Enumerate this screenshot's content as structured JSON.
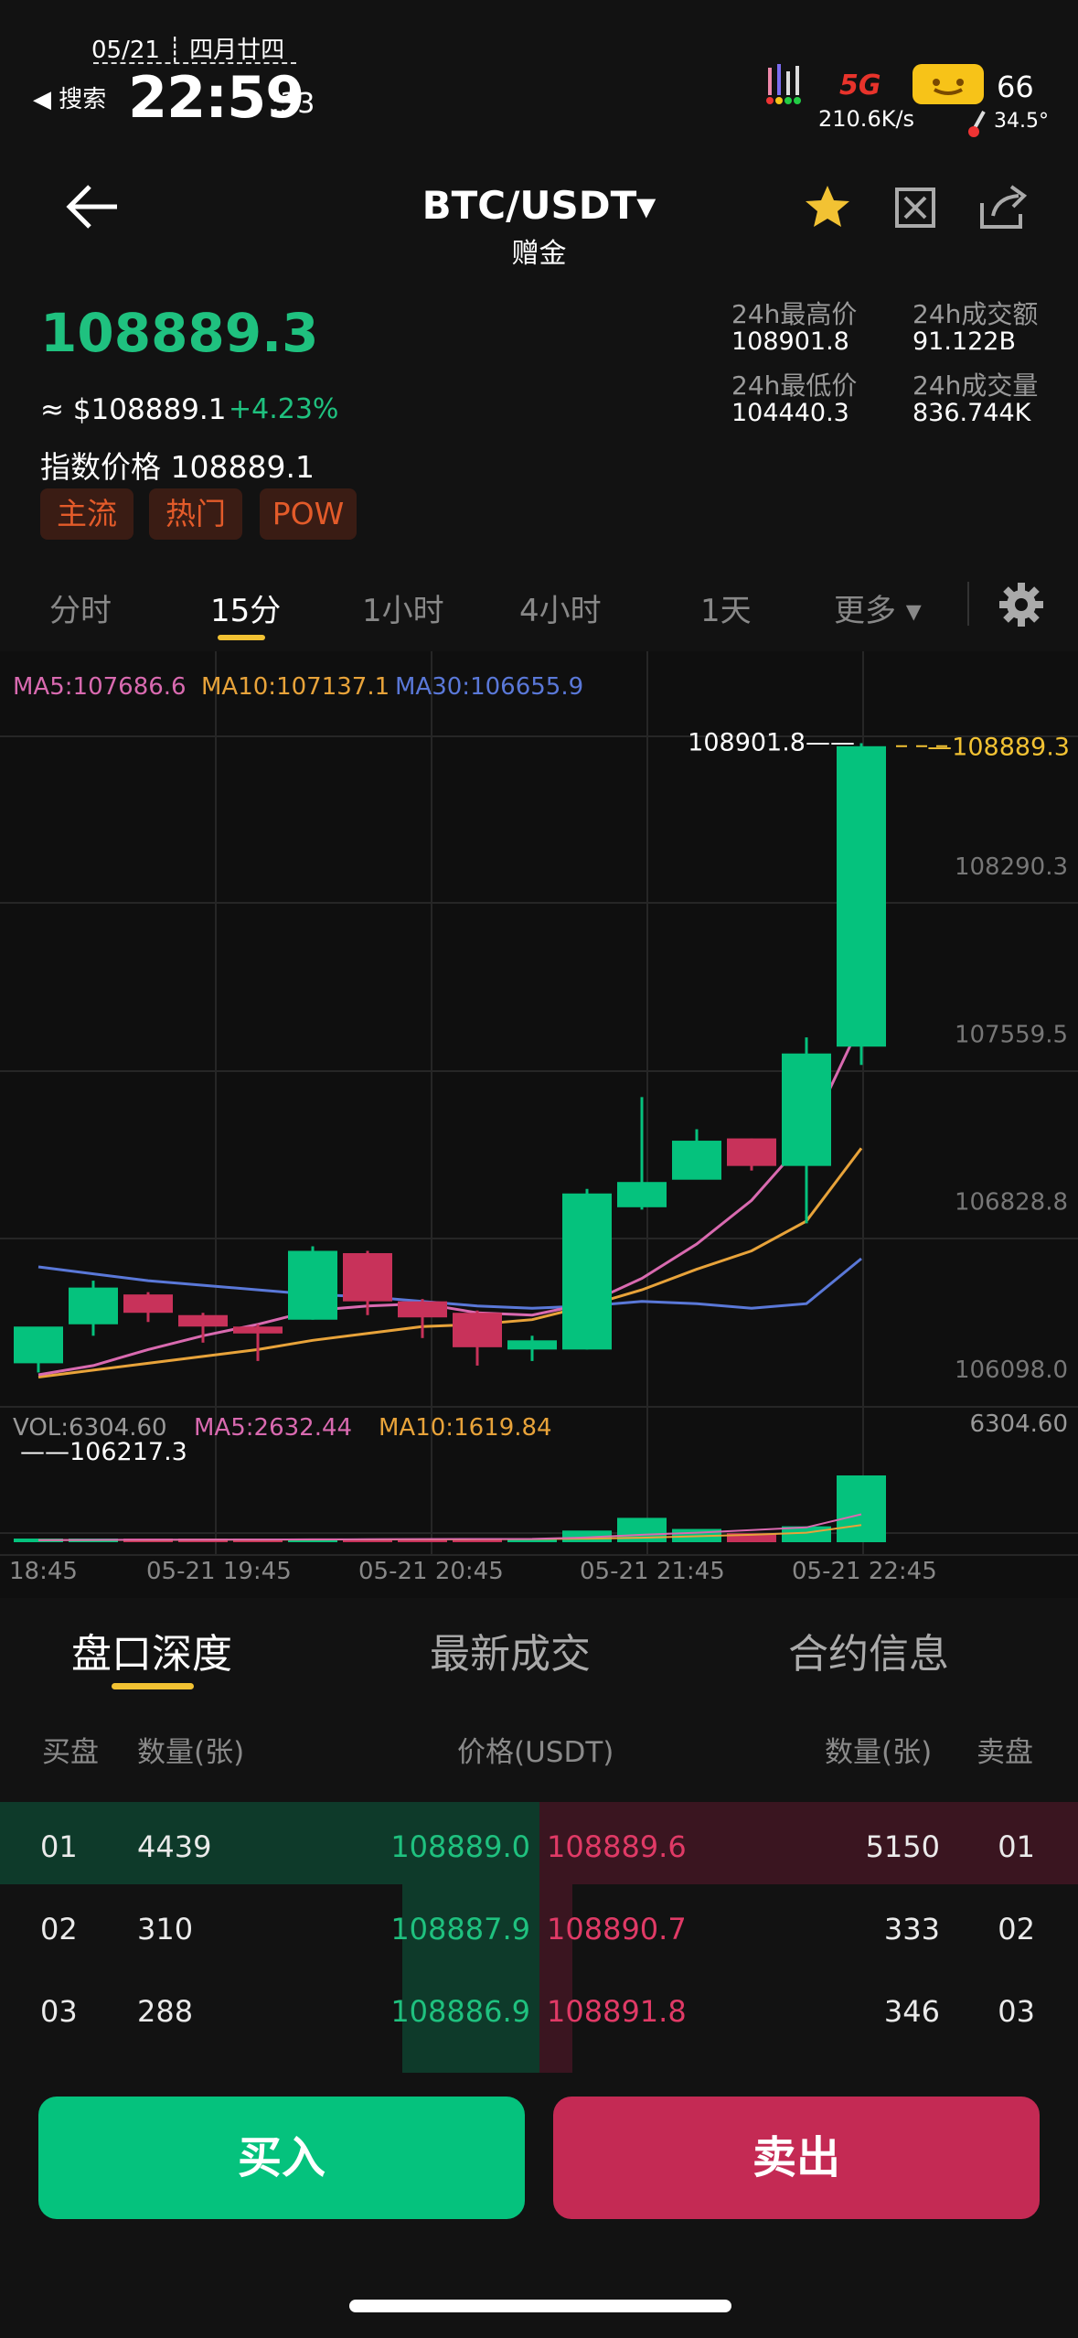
{
  "status_bar": {
    "date": "05/21 ┊ 四月廿四",
    "back_label": "◀ 搜索",
    "time": "22:59",
    "seconds": ":33",
    "net_speed": "210.6K/s",
    "temperature": "34.5°",
    "battery": "66",
    "network": "5G"
  },
  "header": {
    "pair": "BTC/USDT▾",
    "subtitle": "赠金"
  },
  "ticker": {
    "last_price": "108889.3",
    "usd_value": "≈ $108889.1",
    "change_pct": "+4.23%",
    "index_label": "指数价格",
    "index_value": "108889.1",
    "tags": [
      "主流",
      "热门",
      "POW"
    ],
    "stats": {
      "high_label": "24h最高价",
      "high_value": "108901.8",
      "low_label": "24h最低价",
      "low_value": "104440.3",
      "turnover_label": "24h成交额",
      "turnover_value": "91.122B",
      "volume_label": "24h成交量",
      "volume_value": "836.744K"
    }
  },
  "timeframes": {
    "items": [
      "分时",
      "15分",
      "1小时",
      "4小时",
      "1天",
      "更多 ▾"
    ],
    "active": "15分"
  },
  "ma_legend": {
    "ma5": "MA5:107686.6",
    "ma10": "MA10:107137.1",
    "ma30": "MA30:106655.9"
  },
  "volume_legend": {
    "vol": "VOL:6304.60",
    "ma5": "MA5:2632.44",
    "ma10": "MA10:1619.84"
  },
  "colors": {
    "up": "#05c27d",
    "down": "#c8325a",
    "ma5": "#d96ab0",
    "ma10": "#e8a33a",
    "ma30": "#5a78d8",
    "accent": "#f2c233"
  },
  "chart_data": {
    "type": "candlestick",
    "y_ticks": [
      108290.3,
      107559.5,
      106828.8,
      106098.0
    ],
    "y_top_label": "108889.3",
    "high_label": "108901.8",
    "low_label": "106217.3",
    "volume_max_label": "6304.60",
    "x_ticks": [
      "18:45",
      "05-21 19:45",
      "05-21 20:45",
      "05-21 21:45",
      "05-21 22:45"
    ],
    "candles": [
      {
        "o": 106200,
        "h": 106330,
        "c": 106360,
        "l": 106160
      },
      {
        "o": 106370,
        "h": 106560,
        "c": 106530,
        "l": 106320
      },
      {
        "o": 106500,
        "h": 106510,
        "c": 106420,
        "l": 106380
      },
      {
        "o": 106410,
        "h": 106420,
        "c": 106360,
        "l": 106290
      },
      {
        "o": 106360,
        "h": 106370,
        "c": 106330,
        "l": 106210
      },
      {
        "o": 106390,
        "h": 106710,
        "c": 106690,
        "l": 106390
      },
      {
        "o": 106680,
        "h": 106690,
        "c": 106470,
        "l": 106410
      },
      {
        "o": 106470,
        "h": 106480,
        "c": 106400,
        "l": 106310
      },
      {
        "o": 106420,
        "h": 106430,
        "c": 106270,
        "l": 106190
      },
      {
        "o": 106260,
        "h": 106320,
        "c": 106300,
        "l": 106210
      },
      {
        "o": 106260,
        "h": 106960,
        "c": 106940,
        "l": 106260
      },
      {
        "o": 106880,
        "h": 107360,
        "c": 106990,
        "l": 106870
      },
      {
        "o": 107000,
        "h": 107220,
        "c": 107170,
        "l": 107010
      },
      {
        "o": 107180,
        "h": 107180,
        "c": 107060,
        "l": 107040
      },
      {
        "o": 107060,
        "h": 107620,
        "c": 107550,
        "l": 106810
      },
      {
        "o": 107580,
        "h": 108902,
        "c": 108889,
        "l": 107500
      }
    ],
    "volumes": [
      180,
      320,
      210,
      160,
      150,
      330,
      200,
      170,
      180,
      140,
      1100,
      2300,
      1250,
      850,
      1500,
      6304.6
    ],
    "ma5": [
      106150,
      106190,
      106260,
      106320,
      106370,
      106430,
      106450,
      106460,
      106420,
      106410,
      106460,
      106570,
      106720,
      106910,
      107180,
      107686.6
    ],
    "ma10": [
      106140,
      106170,
      106200,
      106230,
      106260,
      106300,
      106330,
      106360,
      106370,
      106390,
      106450,
      106520,
      106610,
      106690,
      106820,
      107137.1
    ],
    "ma30": [
      106620,
      106590,
      106560,
      106540,
      106520,
      106500,
      106490,
      106470,
      106450,
      106440,
      106450,
      106470,
      106460,
      106440,
      106460,
      106655.9
    ]
  },
  "bottom_tabs": [
    "盘口深度",
    "最新成交",
    "合约信息"
  ],
  "orderbook": {
    "headers": {
      "buy": "买盘",
      "qty_left": "数量(张)",
      "price": "价格(USDT)",
      "qty_right": "数量(张)",
      "sell": "卖盘"
    },
    "rows": [
      {
        "idx": "01",
        "bid_qty": "4439",
        "bid": "108889.0",
        "ask": "108889.6",
        "ask_qty": "5150",
        "idx_r": "01"
      },
      {
        "idx": "02",
        "bid_qty": "310",
        "bid": "108887.9",
        "ask": "108890.7",
        "ask_qty": "333",
        "idx_r": "02"
      },
      {
        "idx": "03",
        "bid_qty": "288",
        "bid": "108886.9",
        "ask": "108891.8",
        "ask_qty": "346",
        "idx_r": "03"
      }
    ]
  },
  "actions": {
    "buy": "买入",
    "sell": "卖出"
  }
}
